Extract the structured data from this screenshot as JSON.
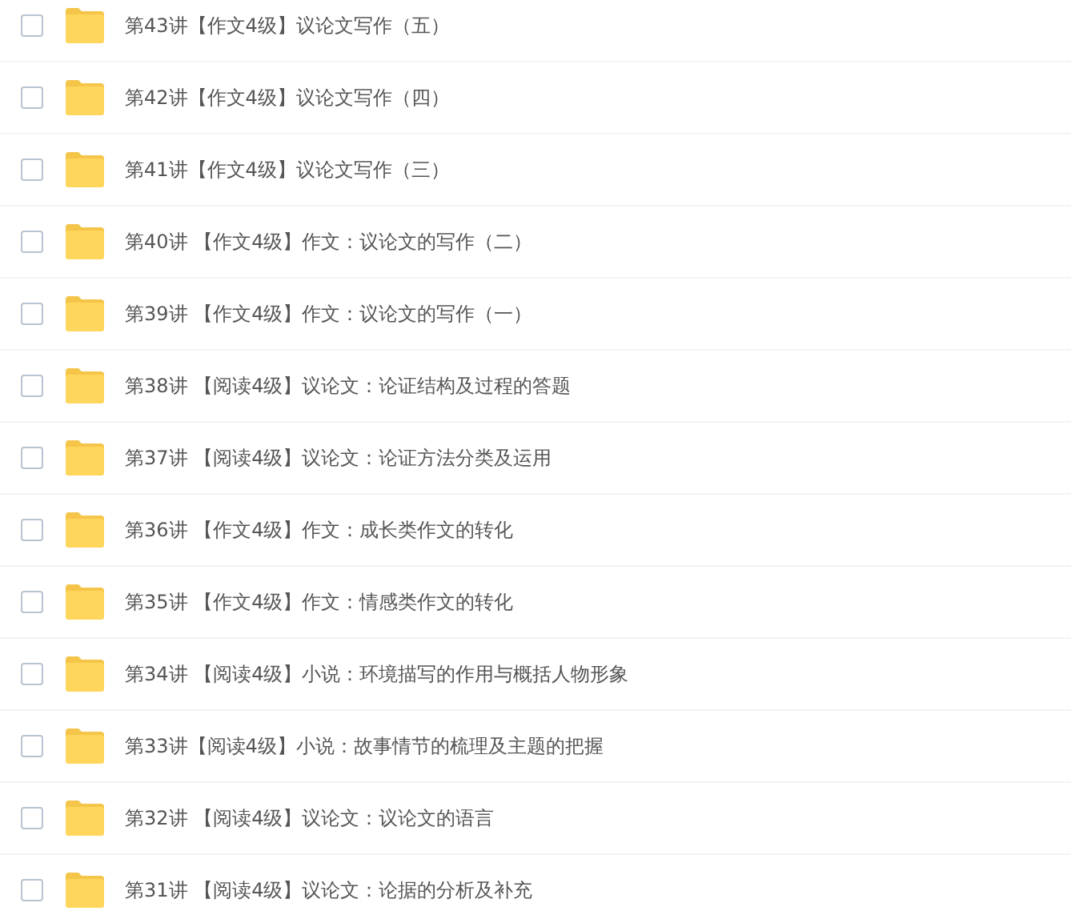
{
  "files": [
    {
      "name": "第43讲【作文4级】议论文写作（五）",
      "checked": false
    },
    {
      "name": "第42讲【作文4级】议论文写作（四）",
      "checked": false
    },
    {
      "name": "第41讲【作文4级】议论文写作（三）",
      "checked": false
    },
    {
      "name": "第40讲 【作文4级】作文：议论文的写作（二）",
      "checked": false
    },
    {
      "name": "第39讲 【作文4级】作文：议论文的写作（一）",
      "checked": false
    },
    {
      "name": "第38讲 【阅读4级】议论文：论证结构及过程的答题",
      "checked": false
    },
    {
      "name": "第37讲 【阅读4级】议论文：论证方法分类及运用",
      "checked": false
    },
    {
      "name": "第36讲 【作文4级】作文：成长类作文的转化",
      "checked": false
    },
    {
      "name": "第35讲 【作文4级】作文：情感类作文的转化",
      "checked": false
    },
    {
      "name": "第34讲 【阅读4级】小说：环境描写的作用与概括人物形象",
      "checked": false
    },
    {
      "name": "第33讲【阅读4级】小说：故事情节的梳理及主题的把握",
      "checked": false
    },
    {
      "name": "第32讲 【阅读4级】议论文：议论文的语言",
      "checked": false
    },
    {
      "name": "第31讲 【阅读4级】议论文：论据的分析及补充",
      "checked": false
    }
  ]
}
